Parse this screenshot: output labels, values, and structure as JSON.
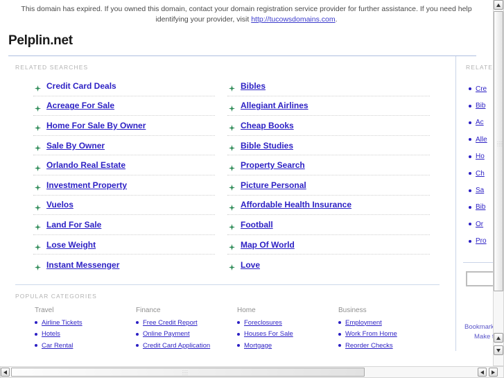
{
  "notice": {
    "text_before": "This domain has expired. If you owned this domain, contact your domain registration service provider for further assistance. If you need help identifying your provider, visit ",
    "link_text": "http://tucowsdomains.com",
    "text_after": "."
  },
  "header": {
    "domain_title": "Pelplin.net"
  },
  "related": {
    "label": "RELATED SEARCHES",
    "left": [
      "Credit Card Deals",
      "Acreage For Sale",
      "Home For Sale By Owner",
      "Sale By Owner",
      "Orlando Real Estate",
      "Investment Property",
      "Vuelos",
      "Land For Sale",
      "Lose Weight",
      "Instant Messenger"
    ],
    "right": [
      "Bibles",
      "Allegiant Airlines",
      "Cheap Books",
      "Bible Studies",
      "Property Search",
      "Picture Personal",
      "Affordable Health Insurance",
      "Football",
      "Map Of World",
      "Love"
    ]
  },
  "sidebar": {
    "label": "RELATED",
    "items": [
      "Cre",
      "Bib",
      "Ac",
      "Alle",
      "Ho",
      "Ch",
      "Sa",
      "Bib",
      "Or",
      "Pro"
    ],
    "search_value": "",
    "search_placeholder": "",
    "footer_line1": "Bookmark",
    "footer_line2": "Make this"
  },
  "categories": {
    "label": "POPULAR CATEGORIES",
    "columns": [
      {
        "heading": "Travel",
        "items": [
          "Airline Tickets",
          "Hotels",
          "Car Rental"
        ]
      },
      {
        "heading": "Finance",
        "items": [
          "Free Credit Report",
          "Online Payment",
          "Credit Card Application"
        ]
      },
      {
        "heading": "Home",
        "items": [
          "Foreclosures",
          "Houses For Sale",
          "Mortgage"
        ]
      },
      {
        "heading": "Business",
        "items": [
          "Employment",
          "Work From Home",
          "Reorder Checks"
        ]
      }
    ]
  },
  "colors": {
    "link": "#2b1fc4",
    "bullet_green": "#2e8b57",
    "label_gray": "#b3b3b3",
    "rule_blue": "#aebfe0"
  }
}
